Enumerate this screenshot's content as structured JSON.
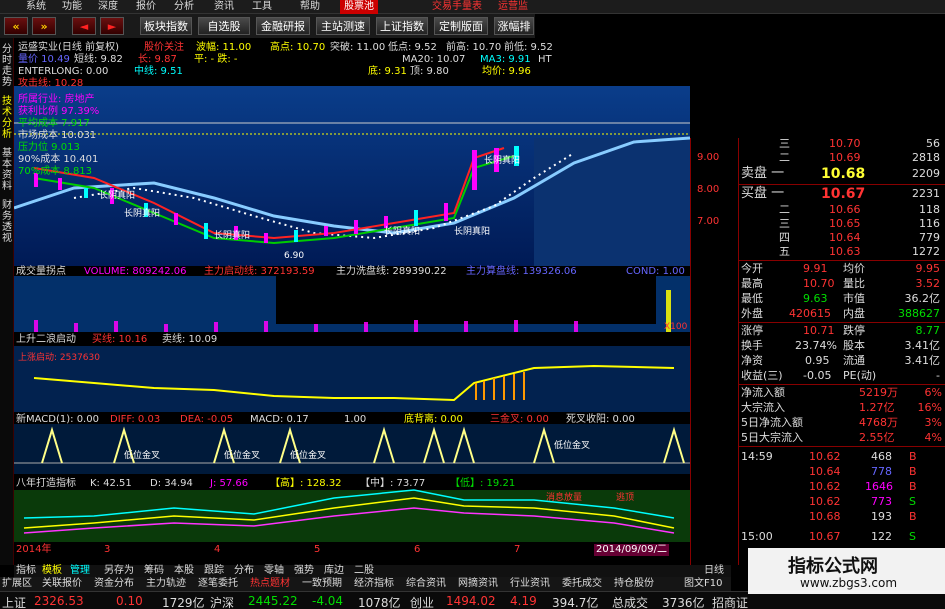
{
  "menu": [
    "系统",
    "功能",
    "深度",
    "报价",
    "分析",
    "资讯",
    "工具",
    "帮助",
    "股票池"
  ],
  "menu_right": [
    "交易手量表",
    "运营监"
  ],
  "toolbar": {
    "nav": [
      "«",
      "»",
      "◄",
      "►"
    ],
    "buttons": [
      "板块指数",
      "自选股",
      "金融研报",
      "主站测速",
      "上证指数",
      "定制版面",
      "涨幅排名"
    ]
  },
  "left_tabs": [
    "分时走势",
    "技术分析",
    "基本资料",
    "财务透视"
  ],
  "header": {
    "row1": [
      "运盛实业(日线 前复权)",
      "股价关注",
      "波幅: 11.00",
      "高点: 10.70",
      "突破: 11.00",
      "低点: 9.52",
      "前高: 10.70",
      "前低: 9.52"
    ],
    "row2": [
      "量价 10.49",
      "短线: 9.82",
      "长: 9.87",
      "平: - 跌: -",
      "MA20: 10.07",
      "MA3: 9.91",
      "HT"
    ],
    "row3": [
      "ENTERLONG: 0.00",
      "中线: 9.51",
      "底: 9.31",
      "顶: 9.80",
      "均价: 9.96"
    ],
    "row4": "攻击线: 10.28"
  },
  "overlay": [
    "所属行业: 房地产",
    "获利比例 97.39%",
    "平均成本 7.917",
    "市场成本 10.031",
    "压力位 9.013",
    "90%成本 10.401",
    "70%成本 8.813"
  ],
  "price_axis": [
    "9.00",
    "8.00",
    "7.00"
  ],
  "candle_labels": [
    "长阴真阳",
    "长阴真阳",
    "长阴真阳",
    "长阴真阳",
    "长阴真阳",
    "长阴真阳",
    "6.90"
  ],
  "volume": {
    "label": "成交量拐点",
    "items": [
      "VOLUME: 809242.06",
      "主力启动线: 372193.59",
      "主力洗盘线: 289390.22",
      "主力算盘线: 139326.06",
      "COND: 1.00"
    ],
    "scale": "X100"
  },
  "wave": {
    "label": "上升二浪启动",
    "buy": "买线: 10.16",
    "sell": "卖线: 10.09",
    "sub": "上涨启动: 2537630"
  },
  "macd": {
    "label": "新MACD(1): 0.00",
    "diff": "DIFF: 0.03",
    "dea": "DEA: -0.05",
    "macd": "MACD: 0.17",
    "v": "1.00",
    "bottom": "底背离: 0.00",
    "cross": "三金叉: 0.00",
    "dead": "死叉收阳: 0.00",
    "marks": [
      "低位金叉",
      "低位金叉",
      "低位金叉",
      "低位金叉"
    ]
  },
  "kdj": {
    "label": "八年打造指标",
    "k": "K: 42.51",
    "d": "D: 34.94",
    "j": "J: 57.66",
    "high": "【高】: 128.32",
    "mid": "【中】: 73.77",
    "low": "【低】: 19.21",
    "tags": [
      "消息放量",
      "逃顶"
    ]
  },
  "dates": [
    "2014年",
    "3",
    "4",
    "5",
    "6",
    "7",
    "2014/09/09/二"
  ],
  "orderbook": [
    {
      "label": "三",
      "price": "10.70",
      "vol": "56"
    },
    {
      "label": "二",
      "price": "10.69",
      "vol": "2818"
    },
    {
      "label": "卖盘 一",
      "price": "10.68",
      "vol": "2209"
    },
    {
      "label": "买盘 一",
      "price": "10.67",
      "vol": "2231"
    },
    {
      "label": "二",
      "price": "10.66",
      "vol": "118"
    },
    {
      "label": "三",
      "price": "10.65",
      "vol": "116"
    },
    {
      "label": "四",
      "price": "10.64",
      "vol": "779"
    },
    {
      "label": "五",
      "price": "10.63",
      "vol": "1272"
    }
  ],
  "stats": [
    [
      "今开",
      "9.91",
      "均价",
      "9.95"
    ],
    [
      "最高",
      "10.70",
      "量比",
      "3.52"
    ],
    [
      "最低",
      "9.63",
      "市值",
      "36.2亿"
    ],
    [
      "外盘",
      "420615",
      "内盘",
      "388627"
    ],
    [
      "涨停",
      "10.71",
      "跌停",
      "8.77"
    ],
    [
      "换手",
      "23.74%",
      "股本",
      "3.41亿"
    ],
    [
      "净资",
      "0.95",
      "流通",
      "3.41亿"
    ],
    [
      "收益(三)",
      "-0.05",
      "PE(动)",
      "-"
    ]
  ],
  "flows": [
    [
      "净流入额",
      "5219万",
      "6%"
    ],
    [
      "大宗流入",
      "1.27亿",
      "16%"
    ],
    [
      "5日净流入额",
      "4768万",
      "3%"
    ],
    [
      "5日大宗流入",
      "2.55亿",
      "4%"
    ]
  ],
  "trades": [
    [
      "14:59",
      "10.62",
      "468",
      "B"
    ],
    [
      "",
      "10.64",
      "778",
      "B"
    ],
    [
      "",
      "10.62",
      "1646",
      "B"
    ],
    [
      "",
      "10.62",
      "773",
      "S"
    ],
    [
      "",
      "10.68",
      "193",
      "B"
    ],
    [
      "15:00",
      "10.67",
      "122",
      "S"
    ]
  ],
  "bottom_tabs": [
    "指标",
    "模板",
    "管理",
    "另存为",
    "筹码",
    "本股",
    "跟踪",
    "分布",
    "零轴",
    "强势",
    "库边",
    "二股",
    "日线"
  ],
  "categories": [
    "扩展区",
    "关联报价",
    "资金分布",
    "主力轨迹",
    "逐笔委托",
    "热点题材",
    "一致预期",
    "经济指标",
    "综合资讯",
    "网摘资讯",
    "行业资讯",
    "委托成交",
    "持仓股份",
    "图文F10"
  ],
  "statusbar": {
    "sh": "上证",
    "sh_v": "2326.53",
    "sh_c": "0.10",
    "sh_a": "1729亿",
    "hs": "沪深",
    "hs_v": "2445.22",
    "hs_c": "-4.04",
    "hs_a": "1078亿",
    "cy": "创业",
    "cy_v": "1494.02",
    "cy_c": "4.19",
    "cy_a": "394.7亿",
    "tot": "总成交",
    "tot_a": "3736亿",
    "ext": "招商证"
  },
  "watermark": {
    "title": "指标公式网",
    "url": "www.zbgs3.com"
  }
}
